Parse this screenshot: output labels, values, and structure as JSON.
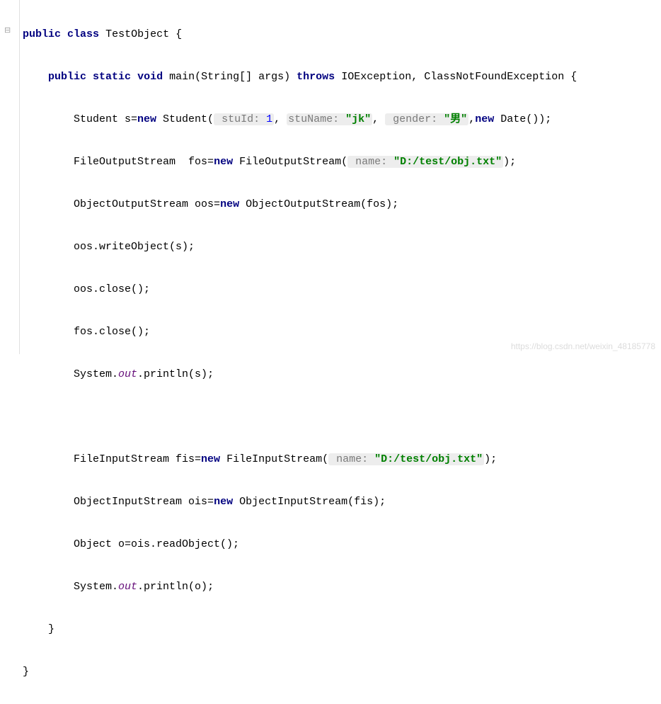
{
  "code": {
    "kw_public": "public",
    "kw_class": "class",
    "kw_static": "static",
    "kw_void": "void",
    "kw_throws": "throws",
    "kw_new": "new",
    "className": "TestObject",
    "mainName": "main",
    "mainParams": "(String[] args)",
    "exceptions": "IOException, ClassNotFoundException",
    "line3": {
      "pre": "Student s=",
      "ctor": " Student(",
      "h1": " stuId: ",
      "v1": "1",
      "c1": ", ",
      "h2": "stuName: ",
      "str1": "\"jk\"",
      "c2": ", ",
      "h3": " gender: ",
      "str2": "\"男\"",
      "c3": ",",
      "ctor2": " Date())",
      "end": ";"
    },
    "line4": {
      "pre": "FileOutputStream  fos=",
      "ctor": " FileOutputStream(",
      "h": " name: ",
      "str": "\"D:/test/obj.txt\"",
      "end": ");"
    },
    "line5": {
      "pre": "ObjectOutputStream oos=",
      "ctor": " ObjectOutputStream(fos);"
    },
    "line6": "oos.writeObject(s);",
    "line7": "oos.close();",
    "line8": "fos.close();",
    "line9a": "System.",
    "line9out": "out",
    "line9b": ".println(s);",
    "line11": {
      "pre": "FileInputStream fis=",
      "ctor": " FileInputStream(",
      "h": " name: ",
      "str": "\"D:/test/obj.txt\"",
      "end": ");"
    },
    "line12": {
      "pre": "ObjectInputStream ois=",
      "ctor": " ObjectInputStream(fis);"
    },
    "line13": "Object o=ois.readObject();",
    "line14a": "System.",
    "line14out": "out",
    "line14b": ".println(o);",
    "indent1": "    ",
    "indent2": "        ",
    "brace_open": " {",
    "brace_close": "}"
  },
  "watermark": "https://blog.csdn.net/weixin_48185778"
}
